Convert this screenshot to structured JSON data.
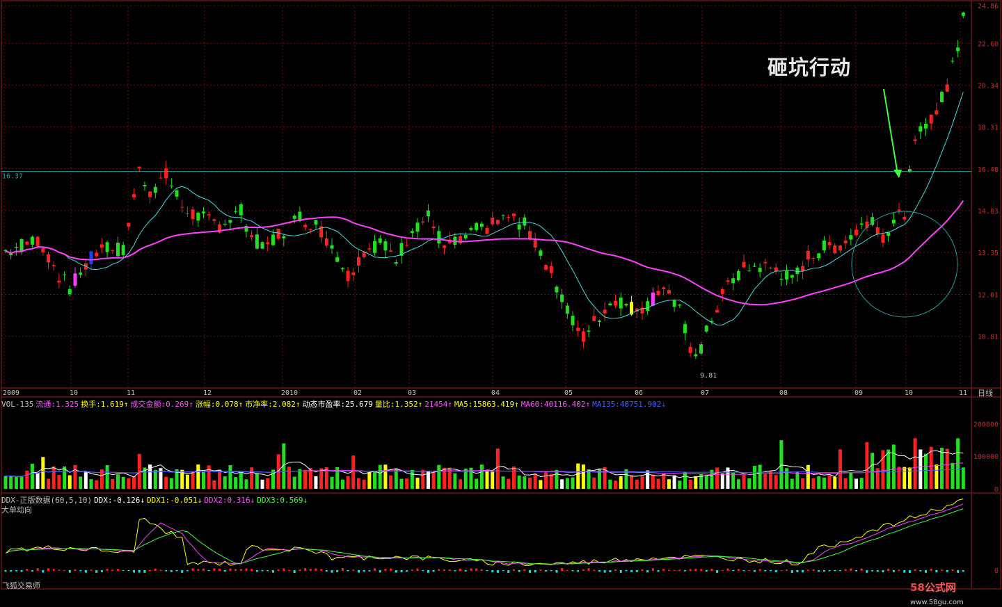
{
  "annotation": "砸坑行动",
  "period_label": "日线",
  "price_panel": {
    "y_ticks": [
      "24.86",
      "22.60",
      "20.34",
      "18.31",
      "16.48",
      "14.83",
      "13.35",
      "12.01",
      "10.81"
    ],
    "ref_label": "16.37",
    "low_label": "9.81"
  },
  "date_axis": [
    "2009",
    "10",
    "11",
    "12",
    "2010",
    "02",
    "03",
    "04",
    "05",
    "06",
    "07",
    "08",
    "09",
    "10",
    "11"
  ],
  "vol_panel": {
    "y_ticks": [
      "200000",
      "100000",
      "0"
    ],
    "info": [
      {
        "text": "VOL-135",
        "color": "#c0c0c0"
      },
      {
        "text": "流通:1.325",
        "color": "#ff50ff"
      },
      {
        "text": "换手:1.619↑",
        "color": "#ffff00"
      },
      {
        "text": "成交金额:0.269↑",
        "color": "#ff50ff"
      },
      {
        "text": "涨幅:0.078↑",
        "color": "#ffff00"
      },
      {
        "text": "市净率:2.082↑",
        "color": "#ffff00"
      },
      {
        "text": "动态市盈率:25.679",
        "color": "#ffffff"
      },
      {
        "text": "量比:1.352↑",
        "color": "#ffff00"
      },
      {
        "text": "21454↑",
        "color": "#ff50ff"
      },
      {
        "text": "MA5:15863.419↑",
        "color": "#ffff00"
      },
      {
        "text": "MA60:40116.402↑",
        "color": "#ff50ff"
      },
      {
        "text": "MA135:48751.902↓",
        "color": "#4060ff"
      }
    ]
  },
  "ddx_panel": {
    "y_ticks": [
      "0"
    ],
    "info": [
      {
        "text": "DDX-正版数据(60,5,10)",
        "color": "#c0c0c0"
      },
      {
        "text": "DDX:-0.126↓",
        "color": "#ffffff"
      },
      {
        "text": "DDX1:-0.051↓",
        "color": "#ffff00"
      },
      {
        "text": "DDX2:0.316↓",
        "color": "#ff50ff"
      },
      {
        "text": "DDX3:0.569↓",
        "color": "#40ff40"
      }
    ],
    "subtitle": "大单动向"
  },
  "footer": "飞狐交易师",
  "watermark": {
    "part1": "58",
    "part2": "公式网",
    "part3": "www.58gu.com"
  },
  "chart_data": {
    "type": "candlestick",
    "title": "",
    "period": "日线",
    "ylim": [
      9.81,
      24.86
    ],
    "log_scale": true,
    "grid": true,
    "price_path": [
      [
        0,
        13.4
      ],
      [
        6,
        13.8
      ],
      [
        10,
        12.6
      ],
      [
        12,
        12.2
      ],
      [
        15,
        12.9
      ],
      [
        18,
        13.6
      ],
      [
        22,
        13.4
      ],
      [
        25,
        16.4
      ],
      [
        27,
        15.6
      ],
      [
        30,
        16.2
      ],
      [
        33,
        15.0
      ],
      [
        36,
        14.6
      ],
      [
        40,
        14.3
      ],
      [
        44,
        14.8
      ],
      [
        46,
        13.9
      ],
      [
        48,
        13.5
      ],
      [
        52,
        14.1
      ],
      [
        55,
        14.6
      ],
      [
        58,
        14.3
      ],
      [
        61,
        13.6
      ],
      [
        64,
        12.6
      ],
      [
        67,
        13.4
      ],
      [
        70,
        13.7
      ],
      [
        73,
        13.1
      ],
      [
        76,
        14.2
      ],
      [
        79,
        14.6
      ],
      [
        82,
        13.5
      ],
      [
        85,
        13.7
      ],
      [
        88,
        14.1
      ],
      [
        91,
        14.3
      ],
      [
        94,
        14.6
      ],
      [
        97,
        14.3
      ],
      [
        100,
        13.4
      ],
      [
        103,
        12.3
      ],
      [
        106,
        11.2
      ],
      [
        108,
        10.8
      ],
      [
        111,
        11.4
      ],
      [
        114,
        11.9
      ],
      [
        117,
        11.6
      ],
      [
        120,
        11.7
      ],
      [
        123,
        12.3
      ],
      [
        126,
        11.5
      ],
      [
        128,
        10.4
      ],
      [
        130,
        10.5
      ],
      [
        132,
        11.3
      ],
      [
        135,
        12.3
      ],
      [
        138,
        12.8
      ],
      [
        141,
        12.9
      ],
      [
        144,
        12.8
      ],
      [
        147,
        12.4
      ],
      [
        150,
        13.2
      ],
      [
        153,
        13.5
      ],
      [
        156,
        13.6
      ],
      [
        159,
        14.1
      ],
      [
        162,
        14.6
      ],
      [
        164,
        13.9
      ],
      [
        166,
        14.4
      ],
      [
        168,
        14.8
      ],
      [
        170,
        17.5
      ],
      [
        172,
        18.6
      ],
      [
        174,
        19.0
      ],
      [
        176,
        20.3
      ],
      [
        178,
        22.6
      ],
      [
        179,
        24.6
      ]
    ],
    "volume_ylim": [
      0,
      250000
    ],
    "series": [
      {
        "name": "MA5",
        "kind": "price"
      },
      {
        "name": "MA60",
        "kind": "price"
      },
      {
        "name": "MA135",
        "kind": "price"
      },
      {
        "name": "DDX1",
        "kind": "ddx"
      },
      {
        "name": "DDX2",
        "kind": "ddx"
      },
      {
        "name": "DDX3",
        "kind": "ddx"
      }
    ],
    "colors": {
      "up": "#ff2020",
      "down": "#20e020",
      "big_up": "#ff40ff",
      "big_down": "#2040ff",
      "flat": "#ffff00",
      "ma5": "#40e0e0",
      "ma60": "#ff40ff",
      "ref_line": "#20a0a0"
    }
  }
}
